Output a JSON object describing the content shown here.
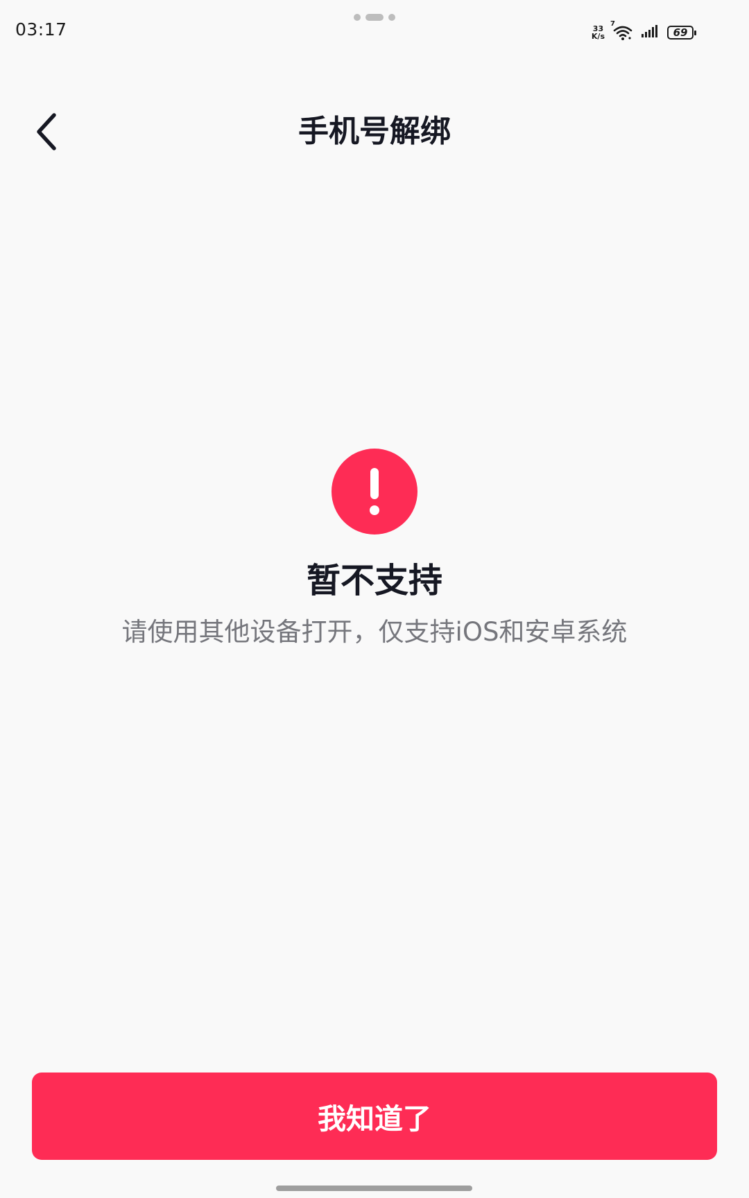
{
  "status_bar": {
    "time": "03:17",
    "net_speed_value": "33",
    "net_speed_unit": "K/s",
    "wifi_badge": "7",
    "battery_level": "69"
  },
  "nav": {
    "title": "手机号解绑"
  },
  "content": {
    "icon": "exclamation-circle-icon",
    "headline": "暂不支持",
    "message": "请使用其他设备打开，仅支持iOS和安卓系统"
  },
  "actions": {
    "confirm_label": "我知道了"
  },
  "colors": {
    "accent": "#fe2c55",
    "background": "#f9f9f9",
    "title_text": "#161823",
    "secondary_text": "#75767c"
  }
}
